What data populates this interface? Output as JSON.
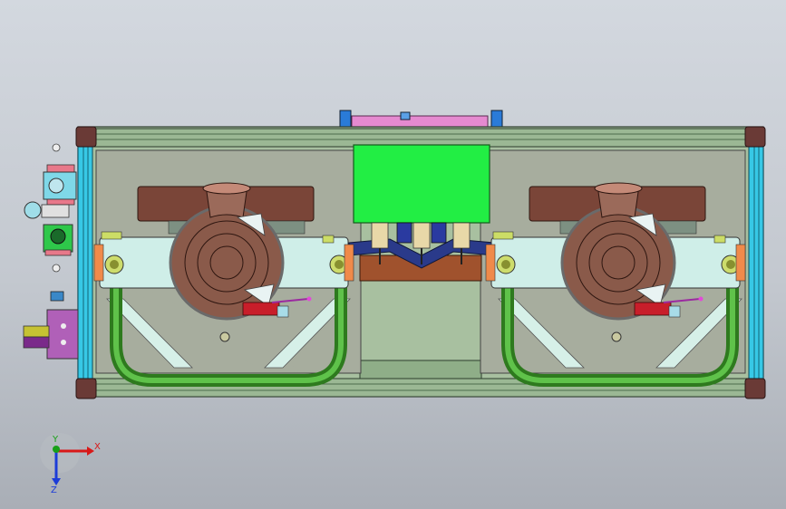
{
  "viewport": {
    "type": "cad-3d-model-view",
    "background": [
      "#d3d8df",
      "#a9aeb6"
    ]
  },
  "triad": {
    "x_label": "X",
    "y_label": "Y",
    "z_label": "Z",
    "x_color": "#d81818",
    "y_color": "#18a018",
    "z_color": "#1c3cd8"
  },
  "model": {
    "frame_color": "#9bb894",
    "rail_color": "#37c8e6",
    "pipe_color": "#3f9a2c",
    "pump_casing_color": "#6e4133",
    "pump_body_color": "#8a5a4a",
    "motor_color": "#a7ad9e",
    "bracket_color": "#cfeee8",
    "control_box_color": "#22ee44",
    "manifold_color": "#a0522d",
    "top_plate_color": "#e58ad0",
    "valve_color": "#9b2aa0"
  }
}
